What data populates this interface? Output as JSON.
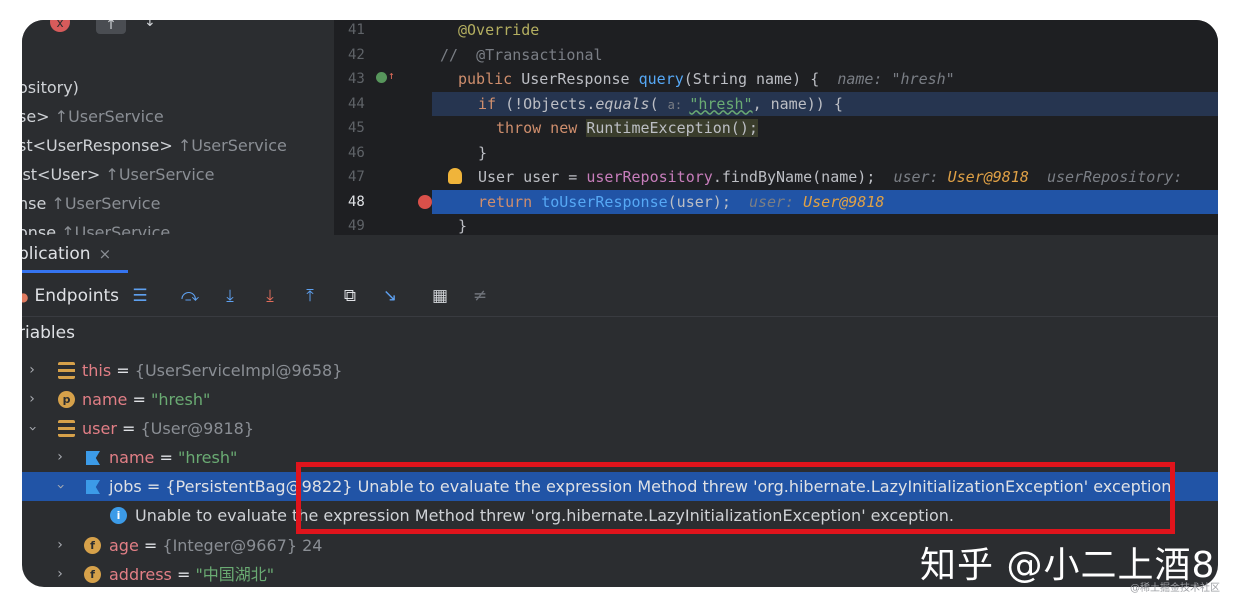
{
  "structure": {
    "toolbar": {
      "close_glyph": "x",
      "up_glyph": "↑",
      "down_glyph": "↓"
    },
    "rows": [
      {
        "text": "ository)",
        "owner": ""
      },
      {
        "text": "se> ",
        "owner": "↑UserService"
      },
      {
        "text": "st<UserResponse> ",
        "owner": "↑UserService"
      },
      {
        "text": "ist<User> ",
        "owner": "↑UserService"
      },
      {
        "text": "nse ",
        "owner": "↑UserService"
      },
      {
        "text": "onse ",
        "owner": "↑UserService"
      }
    ]
  },
  "editor": {
    "line_numbers": [
      "41",
      "42",
      "43",
      "44",
      "45",
      "46",
      "47",
      "48",
      "49"
    ],
    "lines": {
      "l41": "@Override",
      "l42_comment": "//",
      "l42_ann": "@Transactional",
      "l43_pub": "public ",
      "l43_type": "UserResponse ",
      "l43_name": "query",
      "l43_sig": "(String name) {",
      "l43_hint": "name: \"hresh\"",
      "l44_if": "if ",
      "l44_a": "(!Objects.",
      "l44_eq": "equals",
      "l44_b": "( ",
      "l44_param": "a: ",
      "l44_str": "\"hresh\"",
      "l44_c": ", name)) {",
      "l45_throw": "throw new ",
      "l45_rest": "RuntimeException();",
      "l46": "}",
      "l47_a": "User user = ",
      "l47_repo": "userRepository",
      "l47_b": ".findByName(name);",
      "l47_hint1": "user: ",
      "l47_hint1v": "User@9818",
      "l47_hint2": "userRepository: ",
      "l48_ret": "return ",
      "l48_call": "toUserResponse",
      "l48_rest": "(user);",
      "l48_hint": "user: ",
      "l48_hintv": "User@9818",
      "l49": "}"
    }
  },
  "debug": {
    "tab_label": "plication",
    "tab_close": "×",
    "endpoints_label": "Endpoints",
    "variables_header": "riables",
    "variables": [
      {
        "name": "this",
        "eq": " = ",
        "value": "{UserServiceImpl@9658}"
      },
      {
        "name": "name",
        "eq": " = ",
        "value": "\"hresh\"",
        "icon_letter": "p"
      },
      {
        "name": "user",
        "eq": " = ",
        "value": "{User@9818}"
      },
      {
        "name": "name",
        "eq": " = ",
        "value": "\"hresh\""
      },
      {
        "name": "jobs",
        "eq": " = ",
        "value": "{PersistentBag@9822} Unable to evaluate the expression Method threw 'org.hibernate.LazyInitializationException' exception."
      },
      {
        "message": "Unable to evaluate the expression Method threw 'org.hibernate.LazyInitializationException' exception."
      },
      {
        "name": "age",
        "eq": " = ",
        "value": "{Integer@9667} 24",
        "icon_letter": "f"
      },
      {
        "name": "address",
        "eq": " = ",
        "value": "\"中国湖北\"",
        "icon_letter": "f"
      }
    ]
  },
  "watermark": {
    "main": "知乎 @小二上酒8",
    "small": "@稀土掘金技术社区"
  },
  "colors": {
    "highlight_box": "#e0141c",
    "selection": "#2154a6",
    "accent": "#3574f0"
  }
}
